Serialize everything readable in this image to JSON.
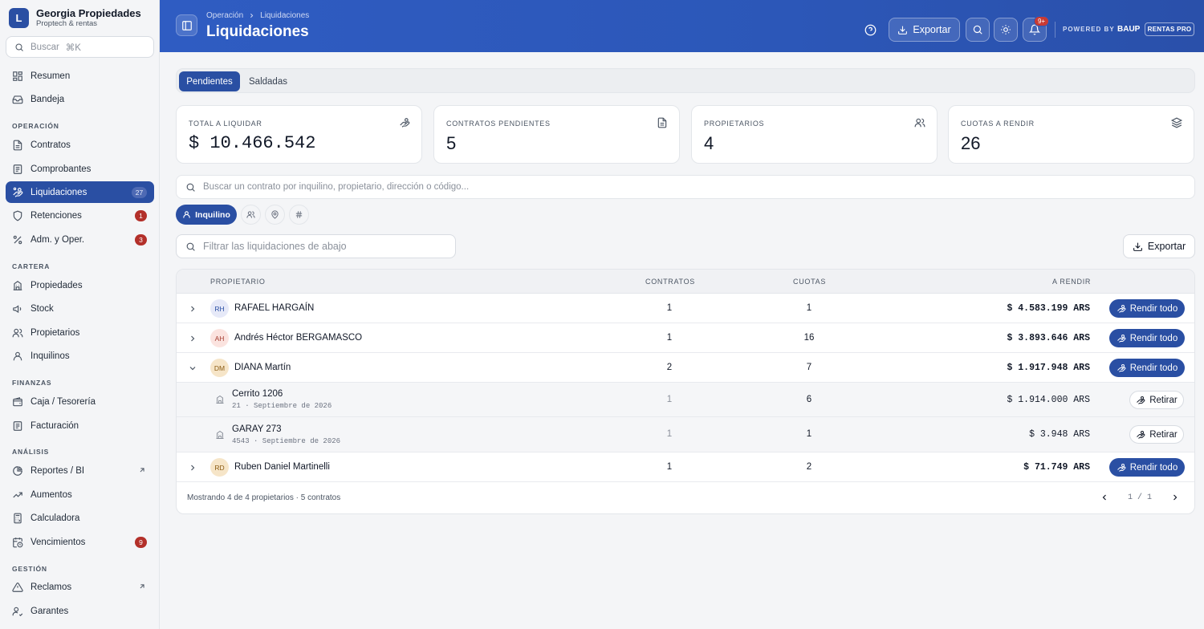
{
  "brand": {
    "initial": "L",
    "name": "Georgia Propiedades",
    "subtitle": "Proptech & rentas"
  },
  "sidebar_search": {
    "placeholder": "Buscar",
    "shortcut": "⌘K"
  },
  "nav": {
    "resumen": "Resumen",
    "bandeja": "Bandeja",
    "sec_operacion": "OPERACIÓN",
    "contratos": "Contratos",
    "comprobantes": "Comprobantes",
    "liquidaciones": "Liquidaciones",
    "liquidaciones_badge": "27",
    "retenciones": "Retenciones",
    "retenciones_badge": "1",
    "adm": "Adm. y Oper.",
    "adm_badge": "3",
    "sec_cartera": "CARTERA",
    "propiedades": "Propiedades",
    "stock": "Stock",
    "propietarios": "Propietarios",
    "inquilinos": "Inquilinos",
    "sec_finanzas": "FINANZAS",
    "caja": "Caja / Tesorería",
    "facturacion": "Facturación",
    "sec_analisis": "ANÁLISIS",
    "reportes": "Reportes / BI",
    "aumentos": "Aumentos",
    "calculadora": "Calculadora",
    "vencimientos": "Vencimientos",
    "vencimientos_badge": "9",
    "sec_gestion": "GESTIÓN",
    "reclamos": "Reclamos",
    "garantes": "Garantes"
  },
  "header": {
    "crumb_parent": "Operación",
    "crumb_current": "Liquidaciones",
    "title": "Liquidaciones",
    "export_label": "Exportar",
    "notif_badge": "9+",
    "powered_by": "POWERED BY",
    "baup": "BAUP",
    "rentas_pro": "RENTAS PRO"
  },
  "tabs": {
    "pendientes": "Pendientes",
    "saldadas": "Saldadas"
  },
  "cards": [
    {
      "label": "TOTAL A LIQUIDAR",
      "value": "$ 10.466.542",
      "icon": "hand-coins-icon"
    },
    {
      "label": "CONTRATOS PENDIENTES",
      "value": "5",
      "icon": "file-text-icon"
    },
    {
      "label": "PROPIETARIOS",
      "value": "4",
      "icon": "users-icon"
    },
    {
      "label": "CUOTAS A RENDIR",
      "value": "26",
      "icon": "layers-icon"
    }
  ],
  "contract_search": {
    "placeholder": "Buscar un contrato por inquilino, propietario, dirección o código..."
  },
  "chips": {
    "inquilino": "Inquilino"
  },
  "filter": {
    "placeholder": "Filtrar las liquidaciones de abajo"
  },
  "export2_label": "Exportar",
  "table": {
    "headers": {
      "propietario": "PROPIETARIO",
      "contratos": "CONTRATOS",
      "cuotas": "CUOTAS",
      "a_rendir": "A RENDIR"
    },
    "rows": [
      {
        "initials": "RH",
        "name": "RAFAEL HARGAÍN",
        "contratos": "1",
        "cuotas": "1",
        "amount": "$ 4.583.199 ARS",
        "action": "Rendir todo"
      },
      {
        "initials": "AH",
        "name": "Andrés Héctor BERGAMASCO",
        "contratos": "1",
        "cuotas": "16",
        "amount": "$ 3.893.646 ARS",
        "action": "Rendir todo"
      },
      {
        "initials": "DM",
        "name": "DIANA Martín",
        "contratos": "2",
        "cuotas": "7",
        "amount": "$ 1.917.948 ARS",
        "action": "Rendir todo"
      },
      {
        "initials": "RD",
        "name": "Ruben Daniel Martinelli",
        "contratos": "1",
        "cuotas": "2",
        "amount": "$ 71.749 ARS",
        "action": "Rendir todo"
      }
    ],
    "subrows": [
      {
        "address": "Cerrito 1206",
        "meta": "21 · Septiembre de 2026",
        "contratos": "1",
        "cuotas": "6",
        "amount": "$ 1.914.000 ARS",
        "action": "Retirar"
      },
      {
        "address": "GARAY 273",
        "meta": "4543 · Septiembre de 2026",
        "contratos": "1",
        "cuotas": "1",
        "amount": "$ 3.948 ARS",
        "action": "Retirar"
      }
    ],
    "footer": "Mostrando 4 de 4 propietarios · 5 contratos",
    "page": "1",
    "pages": "1"
  }
}
